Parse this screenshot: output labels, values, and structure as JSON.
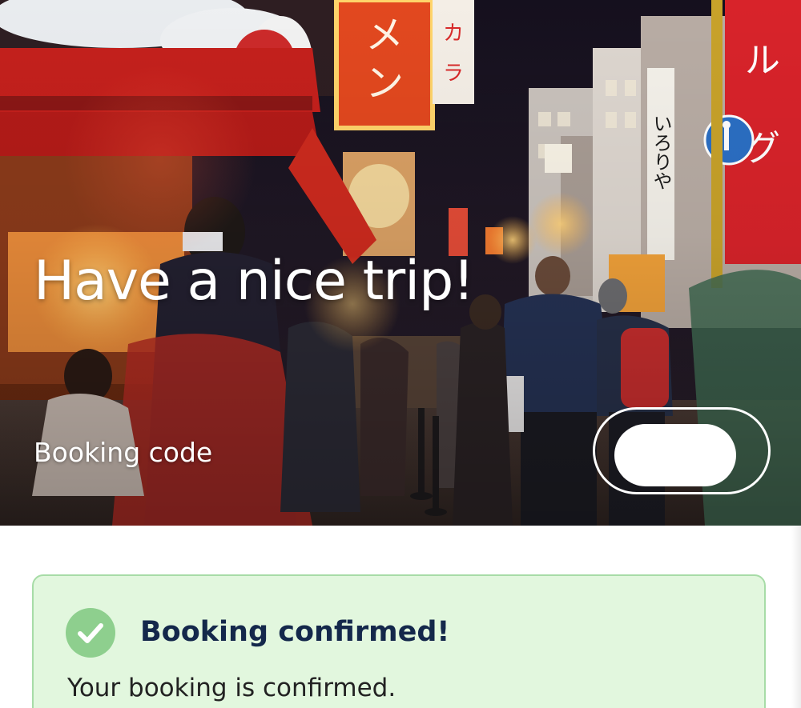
{
  "hero": {
    "title": "Have a nice trip!",
    "image_alt": "Night street scene with neon signs and pedestrians",
    "sign_text_left": "ーメン",
    "sign_text_right": "いろりや"
  },
  "booking": {
    "code_label": "Booking code",
    "code_value": ""
  },
  "confirmation": {
    "icon": "check-circle-icon",
    "title": "Booking confirmed!",
    "message": "Your booking is confirmed."
  },
  "colors": {
    "card_background": "#e2f7de",
    "card_border": "#a7dca7",
    "check_badge": "#8ecf8e",
    "title_text": "#14284b",
    "hero_text": "#ffffff"
  }
}
